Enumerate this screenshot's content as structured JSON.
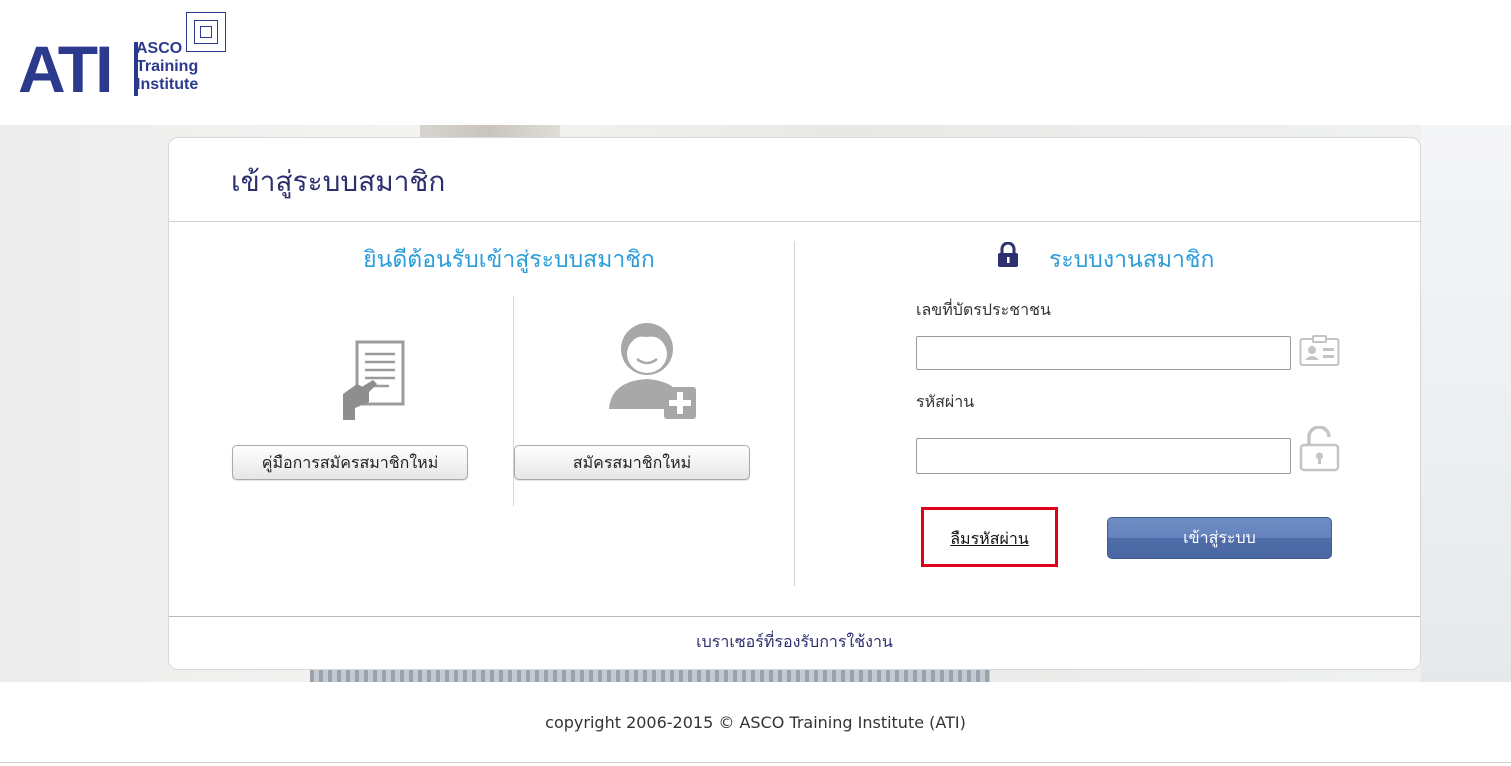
{
  "logo": {
    "brand": "ATI",
    "line1": "ASCO",
    "line2": "Training",
    "line3": "Institute"
  },
  "card": {
    "title": "เข้าสู่ระบบสมาชิก",
    "footer_link": "เบราเซอร์ที่รองรับการใช้งาน"
  },
  "left_panel": {
    "welcome": "ยินดีต้อนรับเข้าสู่ระบบสมาชิก",
    "manual_icon": "document-hand-icon",
    "manual_button": "คู่มือการสมัครสมาชิกใหม่",
    "register_icon": "add-user-icon",
    "register_button": "สมัครสมาชิกใหม่"
  },
  "login_panel": {
    "title": "ระบบงานสมาชิก",
    "title_icon": "lock-icon",
    "id_label": "เลขที่บัตรประชาชน",
    "id_value": "",
    "id_icon": "id-card-icon",
    "password_label": "รหัสผ่าน",
    "password_value": "",
    "password_icon": "unlock-icon",
    "forgot_link": "ลืมรหัสผ่าน",
    "login_button": "เข้าสู่ระบบ"
  },
  "footer": {
    "copyright": "copyright 2006-2015 © ASCO Training Institute (ATI)"
  },
  "colors": {
    "brand": "#2b3a8c",
    "heading_blue": "#2a9dd8",
    "title_navy": "#2d2f6e",
    "login_button": "#5a78b4",
    "highlight_red": "#e0001a"
  }
}
